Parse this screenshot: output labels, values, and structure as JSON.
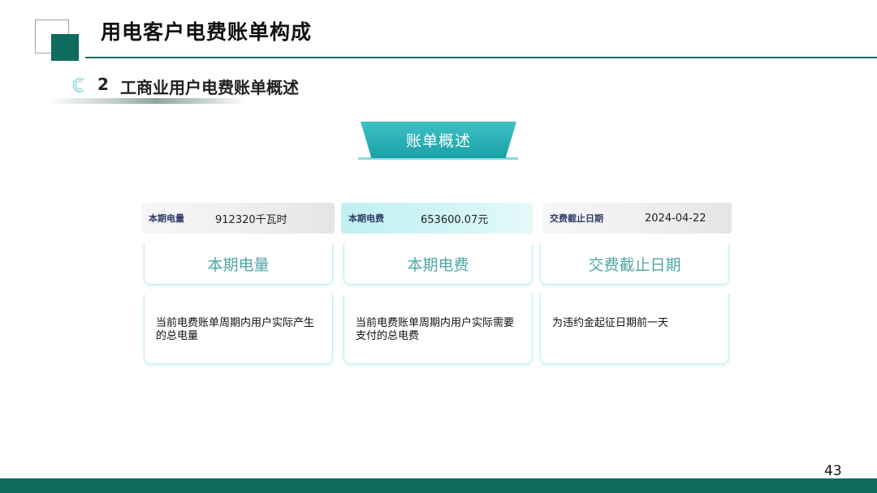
{
  "header": {
    "title": "用电客户电费账单构成"
  },
  "section": {
    "number": "2",
    "title": "工商业用户电费账单概述"
  },
  "banner": {
    "label": "账单概述"
  },
  "strips": [
    {
      "label": "本期电量",
      "value": "912320千瓦时"
    },
    {
      "label": "本期电费",
      "value": "653600.07元"
    },
    {
      "label": "交费截止日期",
      "value": "2024-04-22"
    }
  ],
  "cards": [
    {
      "title": "本期电量",
      "desc": "当前电费账单周期内用户实际产生的总电量"
    },
    {
      "title": "本期电费",
      "desc": "当前电费账单周期内用户实际需要支付的总电费"
    },
    {
      "title": "交费截止日期",
      "desc": "为违约金起征日期前一天"
    }
  ],
  "colors": {
    "brand": "#0e6b5e",
    "accent": "#2bb3b8"
  },
  "footer": {
    "page_number": "43"
  }
}
